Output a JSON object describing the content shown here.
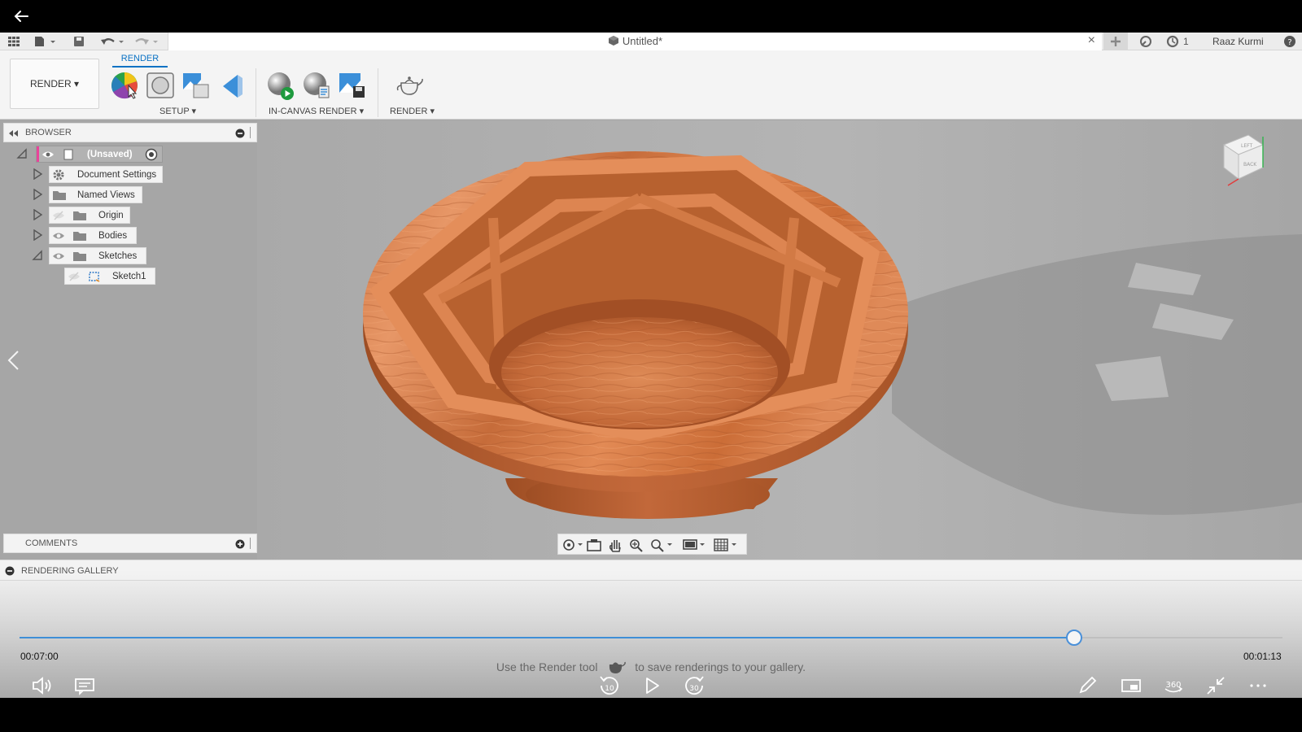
{
  "document": {
    "title": "Untitled*"
  },
  "user": {
    "name": "Raaz Kurmi",
    "job_count": "1"
  },
  "ribbon": {
    "workspace_label": "RENDER ▾",
    "active_tab": "RENDER",
    "groups": {
      "setup": "SETUP ▾",
      "in_canvas": "IN-CANVAS RENDER ▾",
      "render": "RENDER ▾"
    }
  },
  "browser": {
    "title": "BROWSER",
    "root": "(Unsaved)",
    "items": [
      "Document Settings",
      "Named Views",
      "Origin",
      "Bodies",
      "Sketches"
    ],
    "sketch": "Sketch1"
  },
  "comments": {
    "title": "COMMENTS"
  },
  "viewcube": {
    "face_top": "LEFT",
    "face_front": "BACK"
  },
  "gallery": {
    "title": "RENDERING GALLERY",
    "hint_before": "Use the Render tool",
    "hint_after": "to save renderings to your gallery."
  },
  "player": {
    "elapsed": "00:07:00",
    "remaining": "00:01:13",
    "progress": 0.835,
    "skip_back": "10",
    "skip_forward": "30",
    "vr_label": "360"
  },
  "colors": {
    "accent": "#0a72c4",
    "wood_light": "#e58f5c",
    "wood_dark": "#b8602f"
  }
}
